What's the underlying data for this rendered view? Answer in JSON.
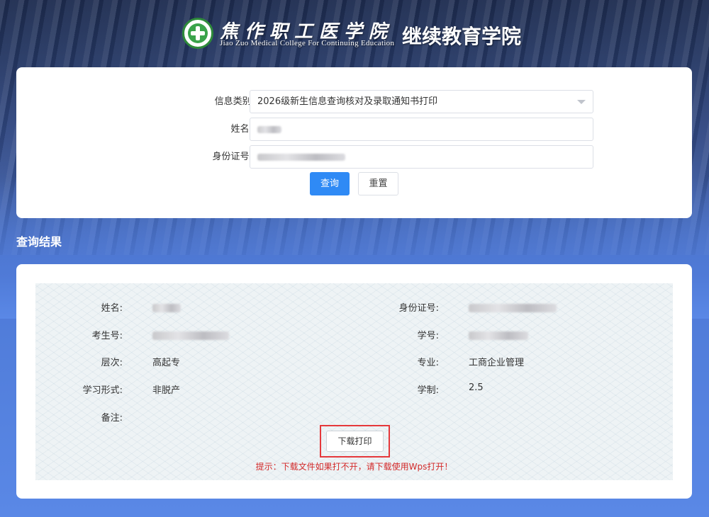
{
  "header": {
    "school_cn": "焦作职工医学院",
    "school_en": "Jiao Zuo Medical College For Continuing Education",
    "college_name": "继续教育学院"
  },
  "query_form": {
    "category_label": "信息类别:",
    "category_value": "2026级新生信息查询核对及录取通知书打印",
    "name_label": "姓名",
    "id_label": "身份证号",
    "required_mark": "*",
    "submit_label": "查询",
    "reset_label": "重置"
  },
  "result": {
    "heading": "查询结果",
    "fields": {
      "name_label": "姓名:",
      "id_label": "身份证号:",
      "exam_no_label": "考生号:",
      "student_no_label": "学号:",
      "level_label": "层次:",
      "level_value": "高起专",
      "major_label": "专业:",
      "major_value": "工商企业管理",
      "mode_label": "学习形式:",
      "mode_value": "非脱产",
      "duration_label": "学制:",
      "duration_value": "2.5",
      "remark_label": "备注:"
    },
    "download_label": "下载打印",
    "hint": "提示：下载文件如果打不开，请下载使用Wps打开！"
  },
  "colors": {
    "primary": "#2f8af5",
    "required": "#e0282c",
    "highlight_border": "#e5383b",
    "hint_text": "#d32a2a"
  }
}
